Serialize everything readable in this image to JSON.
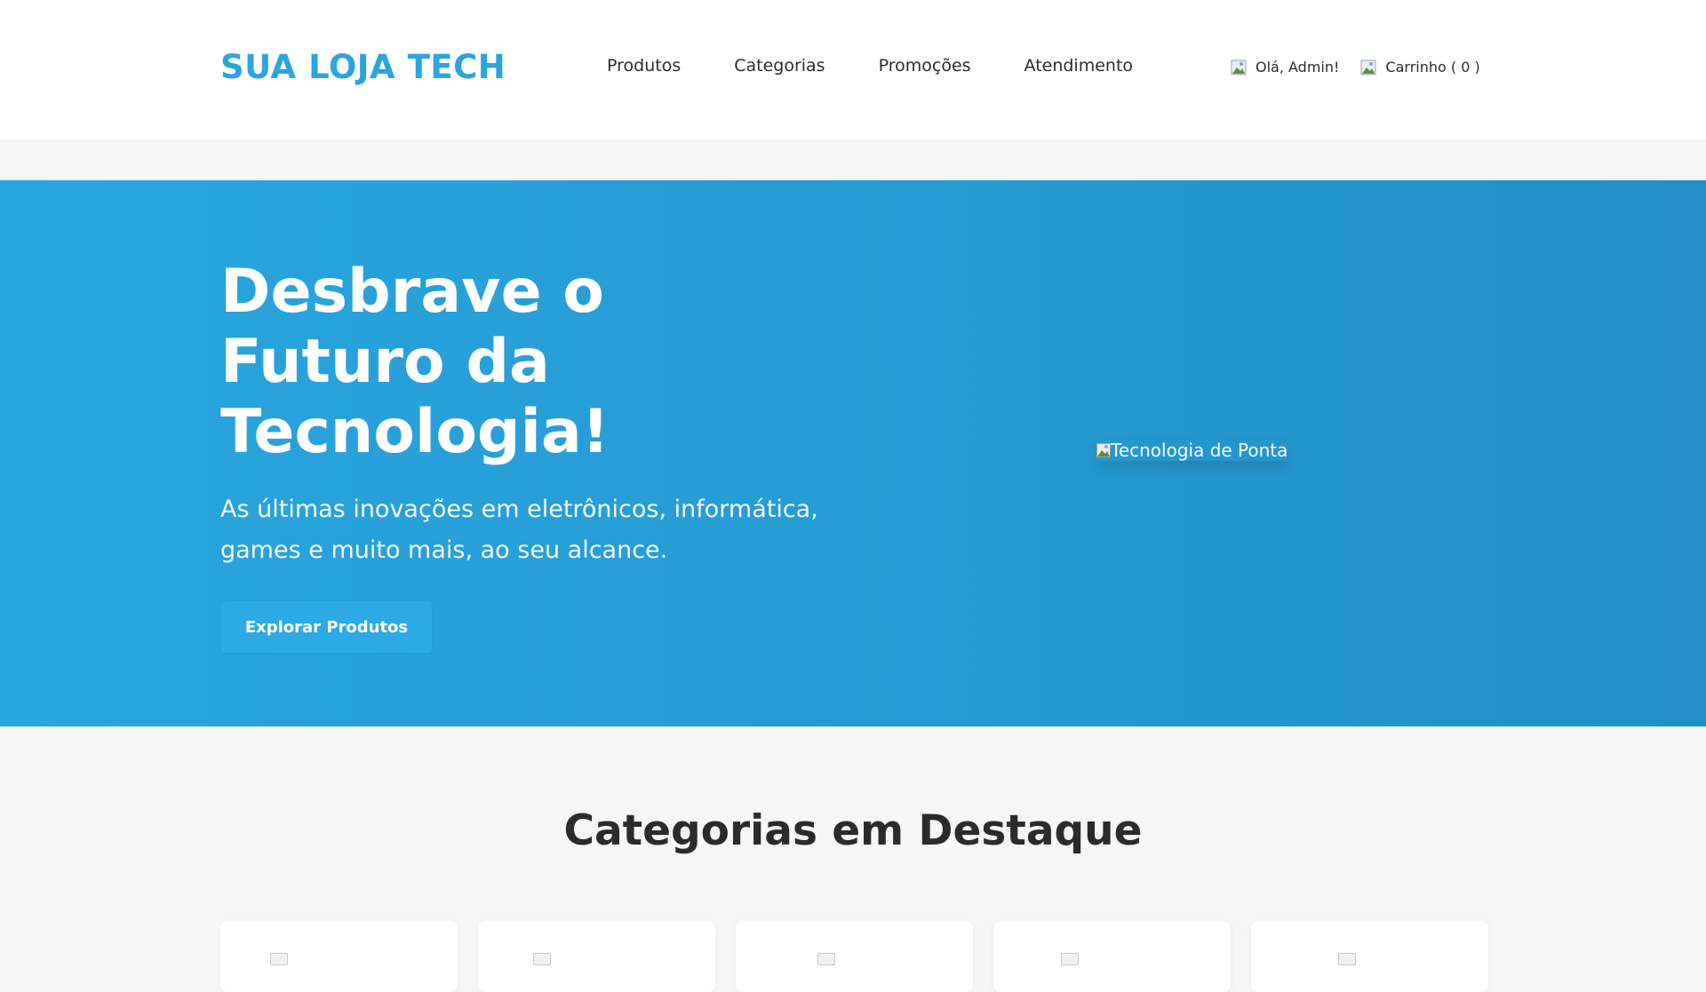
{
  "header": {
    "logo": "SUA LOJA TECH",
    "nav": [
      "Produtos",
      "Categorias",
      "Promoções",
      "Atendimento"
    ],
    "user_greeting": "Olá, Admin!",
    "cart_label": "Carrinho ( 0 )",
    "icons": [
      "user-icon",
      "cart-icon"
    ]
  },
  "hero": {
    "title": "Desbrave o Futuro da Tecnologia!",
    "subtitle": "As últimas inovações em eletrônicos, informática, games e muito mais, ao seu alcance.",
    "cta": "Explorar Produtos",
    "image_alt": "Tecnologia de Ponta"
  },
  "categories": {
    "title": "Categorias em Destaque",
    "count_visible": 5
  },
  "colors": {
    "brand": "#2aa5de",
    "hero_start": "#2aa6e0",
    "hero_end": "#2290c6",
    "button": "#2eaae6",
    "text_dark": "#2b2b2b",
    "page_bg": "#f6f6f6"
  }
}
